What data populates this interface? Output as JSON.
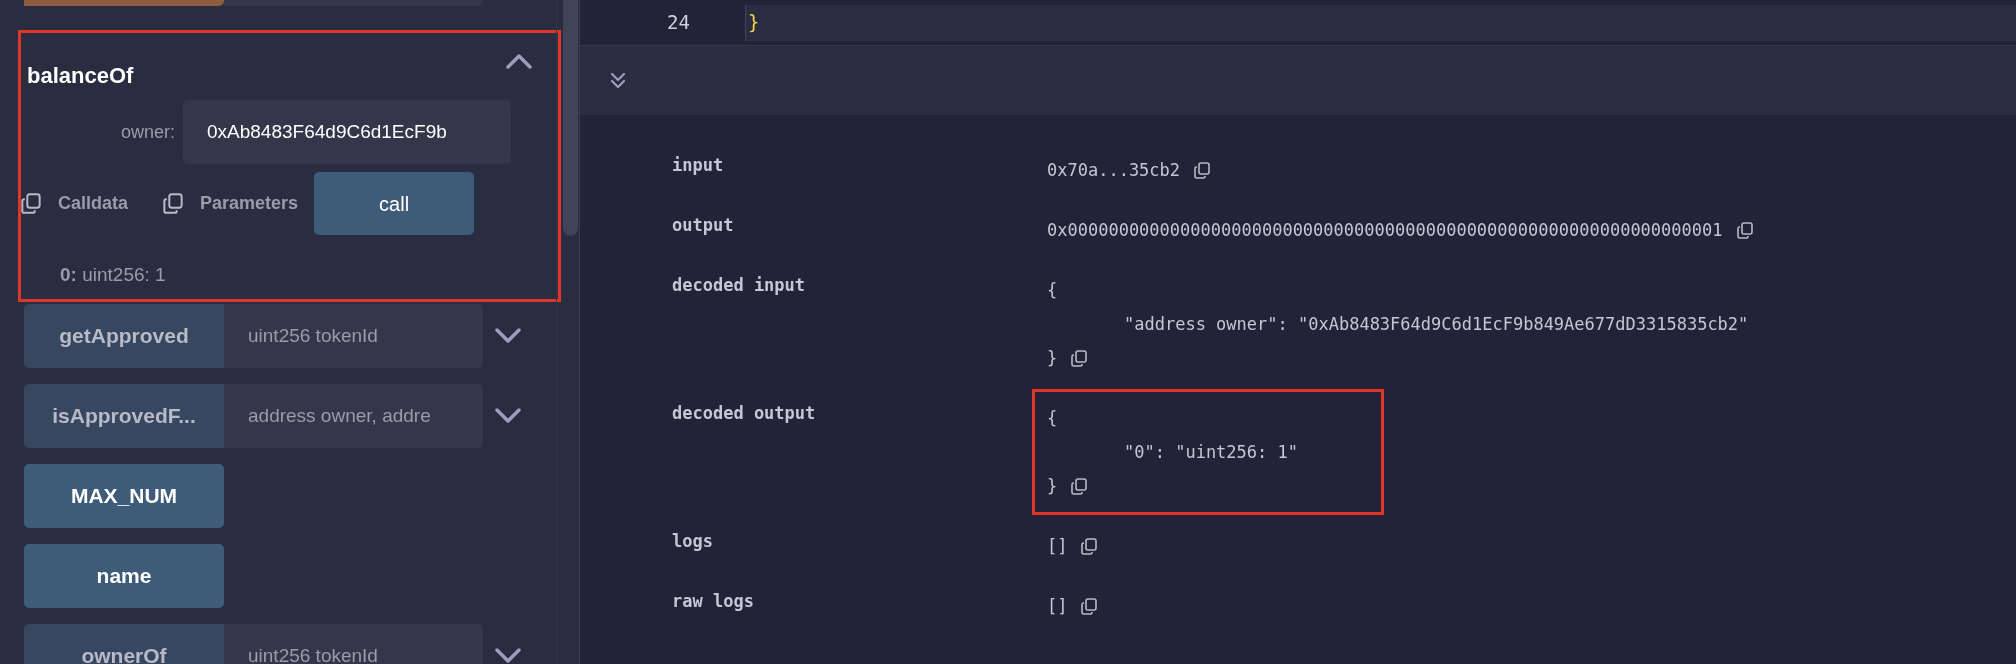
{
  "editor": {
    "line_number": "24",
    "code": "}"
  },
  "functions": [
    {
      "kind": "transact"
    },
    {
      "kind": "expanded",
      "name": "balanceOf",
      "highlighted": true,
      "params": [
        {
          "label": "owner:",
          "value": "0xAb8483F64d9C6d1EcF9b"
        }
      ],
      "copy_actions": [
        "Calldata",
        "Parameters"
      ],
      "button": "call",
      "result": {
        "index": "0:",
        "value": "uint256: 1"
      }
    },
    {
      "kind": "input",
      "name": "getApproved",
      "placeholder": "uint256 tokenId"
    },
    {
      "kind": "input",
      "name": "isApprovedF...",
      "placeholder": "address owner, addre"
    },
    {
      "kind": "plain",
      "name": "MAX_NUM"
    },
    {
      "kind": "plain",
      "name": "name"
    },
    {
      "kind": "input",
      "name": "ownerOf",
      "placeholder": "uint256 tokenId"
    }
  ],
  "details": [
    {
      "label": "input",
      "lines": [
        "0x70a...35cb2"
      ],
      "highlighted": false
    },
    {
      "label": "output",
      "lines": [
        "0x0000000000000000000000000000000000000000000000000000000000000001"
      ],
      "highlighted": false
    },
    {
      "label": "decoded input",
      "lines": [
        "{",
        "\"address owner\": \"0xAb8483F64d9C6d1EcF9b849Ae677dD3315835cb2\"",
        "}"
      ],
      "highlighted": false
    },
    {
      "label": "decoded output",
      "lines": [
        "{",
        "\"0\": \"uint256: 1\"",
        "}"
      ],
      "highlighted": true
    },
    {
      "label": "logs",
      "lines": [
        "[]"
      ],
      "highlighted": false
    },
    {
      "label": "raw logs",
      "lines": [
        "[]"
      ],
      "highlighted": false
    }
  ]
}
